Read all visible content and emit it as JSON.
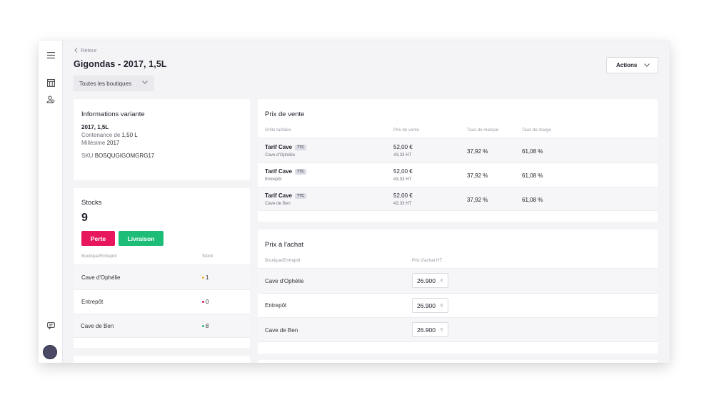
{
  "nav": {
    "back_label": "Retour",
    "icons": [
      "menu-icon",
      "catalog-icon",
      "user-group-icon",
      "chat-icon"
    ]
  },
  "header": {
    "title": "Gigondas - 2017, 1,5L",
    "store_filter": "Toutes les boutiques",
    "actions_label": "Actions"
  },
  "variant_info": {
    "title": "Informations variante",
    "name": "2017, 1,5L",
    "capacity_label": "Contenance de",
    "capacity_value": "1,50 L",
    "vintage_label": "Millésime",
    "vintage_value": "2017",
    "sku_label": "SKU",
    "sku_value": "BOSQUGIGOMGRG17"
  },
  "stocks": {
    "title": "Stocks",
    "total": "9",
    "loss_button": "Perte",
    "delivery_button": "Livraison",
    "columns": [
      "Boutique/Entrepôt",
      "Stock"
    ],
    "rows": [
      {
        "store": "Cave d'Ophélie",
        "qty": "1",
        "status_color": "#f0b429"
      },
      {
        "store": "Entrepôt",
        "qty": "0",
        "status_color": "#d81b60"
      },
      {
        "store": "Cave de Ben",
        "qty": "8",
        "status_color": "#21b573"
      }
    ]
  },
  "sale_price": {
    "title": "Prix de vente",
    "columns": [
      "Grille tarifaire",
      "Prix de vente",
      "Taux de marque",
      "Taux de marge"
    ],
    "ttc_badge": "TTC",
    "rows": [
      {
        "grid": "Tarif Cave",
        "store": "Cave d'Ophélie",
        "price": "52,00 €",
        "price_ht": "43,33 HT",
        "markup_rate": "37,92 %",
        "margin_rate": "61,08 %"
      },
      {
        "grid": "Tarif Cave",
        "store": "Entrepôt",
        "price": "52,00 €",
        "price_ht": "43,33 HT",
        "markup_rate": "37,92 %",
        "margin_rate": "61,08 %"
      },
      {
        "grid": "Tarif Cave",
        "store": "Cave de Ben",
        "price": "52,00 €",
        "price_ht": "43,33 HT",
        "markup_rate": "37,92 %",
        "margin_rate": "61,08 %"
      }
    ]
  },
  "purchase_price": {
    "title": "Prix à l'achat",
    "columns": [
      "Boutique/Entrepôt",
      "Prix d'achat HT"
    ],
    "currency": "€",
    "rows": [
      {
        "store": "Cave d'Ophélie",
        "value": "26.900"
      },
      {
        "store": "Entrepôt",
        "value": "26.900"
      },
      {
        "store": "Cave de Ben",
        "value": "26.900"
      }
    ]
  },
  "colors": {
    "loss": "#e8175d",
    "delivery": "#1dbd78",
    "avatar": "#4a4a66"
  }
}
